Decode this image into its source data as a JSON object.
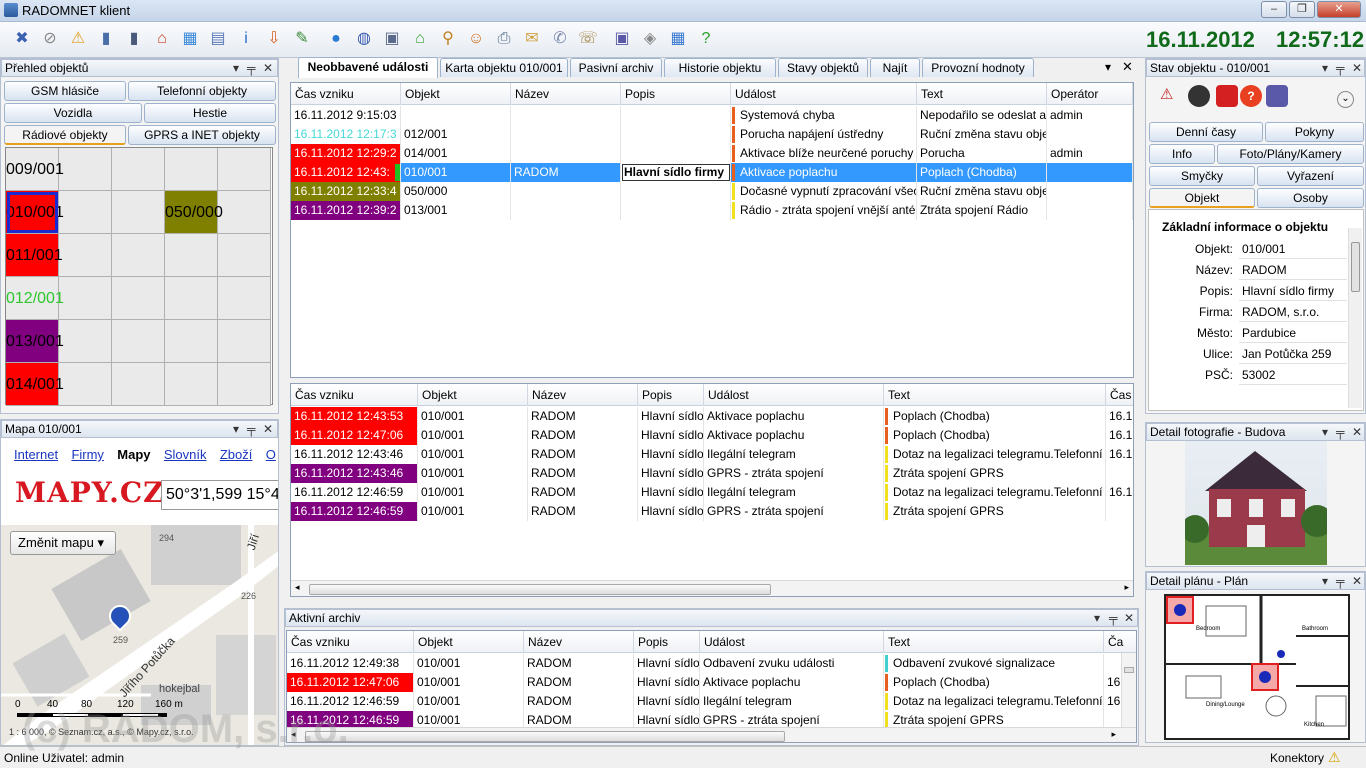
{
  "window": {
    "title": "RADOMNET klient",
    "min": "–",
    "max": "❐",
    "close": "✕"
  },
  "toolbar": {
    "icons": [
      "user-alert-icon",
      "object-remove-icon",
      "warning-doc-icon",
      "server-icon",
      "server2-icon",
      "house-alarm-icon",
      "calendar-grid-icon",
      "document-icon",
      "info-icon",
      "export-icon",
      "edit-note-icon",
      "globe-icon",
      "network-globe-icon",
      "monitor-check-icon",
      "house-green-icon",
      "search-icon",
      "users-icon",
      "printer-icon",
      "mail-icon",
      "chat-icon",
      "phone-icon",
      "camera-icon",
      "tools-icon",
      "calendar-info-icon",
      "help-icon"
    ],
    "date": "16.11.2012",
    "time": "12:57:12"
  },
  "left_panel": {
    "title": "Přehled objektů",
    "pin": "⊟",
    "pin2": "╤",
    "close": "✕",
    "buttons": [
      "GSM hlásiče",
      "Telefonní objekty",
      "Vozidla",
      "Hestie",
      "Rádiové objekty",
      "GPRS a INET objekty"
    ],
    "grid": [
      {
        "label": "009/001",
        "bg": "#eaeaea",
        "fg": "#000"
      },
      {
        "label": "010/001",
        "bg": "#ff0000",
        "fg": "#000"
      },
      {
        "label": "011/001",
        "bg": "#ff0000",
        "fg": "#000"
      },
      {
        "label": "012/001",
        "bg": "#eaeaea",
        "fg": "#2ec82e"
      },
      {
        "label": "013/001",
        "bg": "#800080",
        "fg": "#000"
      },
      {
        "label": "014/001",
        "bg": "#ff0000",
        "fg": "#000"
      },
      {
        "label": "050/000",
        "bg": "#808000",
        "fg": "#000"
      }
    ]
  },
  "map_panel": {
    "title": "Mapa 010/001",
    "links": [
      "Internet",
      "Firmy",
      "Mapy",
      "Slovník",
      "Zboží",
      "O"
    ],
    "logo": "MAPY.CZ",
    "coords": "50°3'1,599 15°4",
    "change_map": "Změnit mapu",
    "street": "Jiřího Potůčka",
    "street2": "Jiří",
    "place": "hokejbal",
    "numbers": [
      "294",
      "226",
      "259"
    ],
    "scale": [
      "0",
      "40",
      "80",
      "120",
      "160 m"
    ],
    "footer": "1 : 6 000, © Seznam.cz, a.s., © Mapy.cz, s.r.o."
  },
  "center": {
    "tabs": [
      "Neobbavené události",
      "Karta objektu 010/001",
      "Pasivní archiv",
      "Historie objektu",
      "Stavy objektů",
      "Najít",
      "Provozní hodnoty"
    ],
    "top_table": {
      "headers": [
        "Čas vzniku",
        "Objekt",
        "Název",
        "Popis",
        "Událost",
        "Text",
        "Operátor"
      ],
      "rows": [
        {
          "time": "16.11.2012   9:15:03",
          "obj": "",
          "name": "",
          "desc": "",
          "event": "Systemová chyba",
          "text": "Nepodařilo se odeslat a",
          "op": "admin",
          "tbg": "#ffffff",
          "tfg": "#000",
          "mark": "#e86020",
          "sel": false
        },
        {
          "time": "16.11.2012   12:17:3",
          "obj": "012/001",
          "name": "",
          "desc": "",
          "event": "Porucha napájení ústředny",
          "text": "Ruční změna stavu obje",
          "op": "",
          "tbg": "#ffffff",
          "tfg": "#44d8d8",
          "mark": "#e86020",
          "sel": false
        },
        {
          "time": "16.11.2012   12:29:2",
          "obj": "014/001",
          "name": "",
          "desc": "",
          "event": "Aktivace blíže neurčené poruchy",
          "text": "Porucha",
          "op": "admin",
          "tbg": "#ff0000",
          "tfg": "#fff",
          "mark": "#e86020",
          "sel": false
        },
        {
          "time": "16.11.2012   12:43:",
          "obj": "010/001",
          "name": "RADOM",
          "desc": "Hlavní sídlo firmy",
          "event": "Aktivace poplachu",
          "text": "Poplach (Chodba)",
          "op": "",
          "tbg": "#ff0000",
          "tfg": "#fff",
          "mark": "#e86020",
          "sel": true
        },
        {
          "time": "16.11.2012   12:33:4",
          "obj": "050/000",
          "name": "",
          "desc": "",
          "event": "Dočasné vypnutí zpracování všec",
          "text": "Ruční změna stavu obje",
          "op": "",
          "tbg": "#808000",
          "tfg": "#fff",
          "mark": "#f0e020",
          "sel": false
        },
        {
          "time": "16.11.2012   12:39:2",
          "obj": "013/001",
          "name": "",
          "desc": "",
          "event": "Rádio - ztráta spojení vnější anté",
          "text": "Ztráta spojení Rádio",
          "op": "",
          "tbg": "#800080",
          "tfg": "#fff",
          "mark": "#f0e020",
          "sel": false
        }
      ]
    },
    "mid_table": {
      "headers": [
        "Čas vzniku",
        "Objekt",
        "Název",
        "Popis",
        "Událost",
        "Text",
        "Čas"
      ],
      "rows": [
        {
          "time": "16.11.2012   12:43:53",
          "obj": "010/001",
          "name": "RADOM",
          "desc": "Hlavní sídlo",
          "event": "Aktivace poplachu",
          "text": "Poplach (Chodba)",
          "last": "16.1",
          "tbg": "#ff0000",
          "mark": "#e86020"
        },
        {
          "time": "16.11.2012   12:47:06",
          "obj": "010/001",
          "name": "RADOM",
          "desc": "Hlavní sídlo",
          "event": "Aktivace poplachu",
          "text": "Poplach (Chodba)",
          "last": "16.1",
          "tbg": "#ff0000",
          "mark": "#e86020"
        },
        {
          "time": "16.11.2012   12:43:46",
          "obj": "010/001",
          "name": "RADOM",
          "desc": "Hlavní sídlo",
          "event": "Ilegální telegram",
          "text": "Dotaz na legalizaci telegramu.Telefonní",
          "last": "16.1",
          "tbg": "#ffffff",
          "mark": "#f0e020"
        },
        {
          "time": "16.11.2012   12:43:46",
          "obj": "010/001",
          "name": "RADOM",
          "desc": "Hlavní sídlo",
          "event": "GPRS - ztráta spojení",
          "text": "Ztráta spojení GPRS",
          "last": "",
          "tbg": "#800080",
          "mark": "#f0e020"
        },
        {
          "time": "16.11.2012   12:46:59",
          "obj": "010/001",
          "name": "RADOM",
          "desc": "Hlavní sídlo",
          "event": "Ilegální telegram",
          "text": "Dotaz na legalizaci telegramu.Telefonní",
          "last": "16.1",
          "tbg": "#ffffff",
          "mark": "#f0e020"
        },
        {
          "time": "16.11.2012   12:46:59",
          "obj": "010/001",
          "name": "RADOM",
          "desc": "Hlavní sídlo",
          "event": "GPRS - ztráta spojení",
          "text": "Ztráta spojení GPRS",
          "last": "",
          "tbg": "#800080",
          "mark": "#f0e020"
        }
      ]
    },
    "archive": {
      "title": "Aktivní archiv",
      "headers": [
        "Čas vzniku",
        "Objekt",
        "Název",
        "Popis",
        "Událost",
        "Text",
        "Ča"
      ],
      "rows": [
        {
          "time": "16.11.2012   12:49:38",
          "obj": "010/001",
          "name": "RADOM",
          "desc": "Hlavní sídlo",
          "event": "Odbavení zvuku události",
          "text": "Odbavení zvukové signalizace",
          "last": "",
          "tbg": "#ffffff",
          "mark": "#40d0d0"
        },
        {
          "time": "16.11.2012   12:47:06",
          "obj": "010/001",
          "name": "RADOM",
          "desc": "Hlavní sídlo",
          "event": "Aktivace poplachu",
          "text": "Poplach (Chodba)",
          "last": "16",
          "tbg": "#ff0000",
          "mark": "#e86020"
        },
        {
          "time": "16.11.2012   12:46:59",
          "obj": "010/001",
          "name": "RADOM",
          "desc": "Hlavní sídlo",
          "event": "Ilegální telegram",
          "text": "Dotaz na legalizaci telegramu.Telefonní",
          "last": "16",
          "tbg": "#ffffff",
          "mark": "#f0e020"
        },
        {
          "time": "16.11.2012   12:46:59",
          "obj": "010/001",
          "name": "RADOM",
          "desc": "Hlavní sídlo",
          "event": "GPRS - ztráta spojení",
          "text": "Ztráta spojení GPRS",
          "last": "",
          "tbg": "#800080",
          "mark": "#f0e020"
        }
      ]
    }
  },
  "right_panel": {
    "title": "Stav objektu - 010/001",
    "buttons": [
      "Denní časy",
      "Pokyny",
      "Info",
      "Foto/Plány/Kamery",
      "Smyčky",
      "Vyřazení",
      "Objekt",
      "Osoby"
    ],
    "info_title": "Základní informace o objektu",
    "fields": [
      {
        "k": "Objekt:",
        "v": "010/001"
      },
      {
        "k": "Název:",
        "v": "RADOM"
      },
      {
        "k": "Popis:",
        "v": "Hlavní sídlo firmy"
      },
      {
        "k": "Firma:",
        "v": "RADOM, s.r.o."
      },
      {
        "k": "Město:",
        "v": "Pardubice"
      },
      {
        "k": "Ulice:",
        "v": "Jan Potůčka 259"
      },
      {
        "k": "PSČ:",
        "v": "53002"
      }
    ],
    "photo_title": "Detail fotografie - Budova",
    "plan_title": "Detail plánu - Plán",
    "plan_rooms": [
      "Bedroom",
      "Bathroom",
      "Dining/Lounge",
      "Kitchen"
    ]
  },
  "status": {
    "left": "Online  Uživatel: admin",
    "right": "Konektory",
    "watermark": "(c) RADOM, s.r.o."
  }
}
